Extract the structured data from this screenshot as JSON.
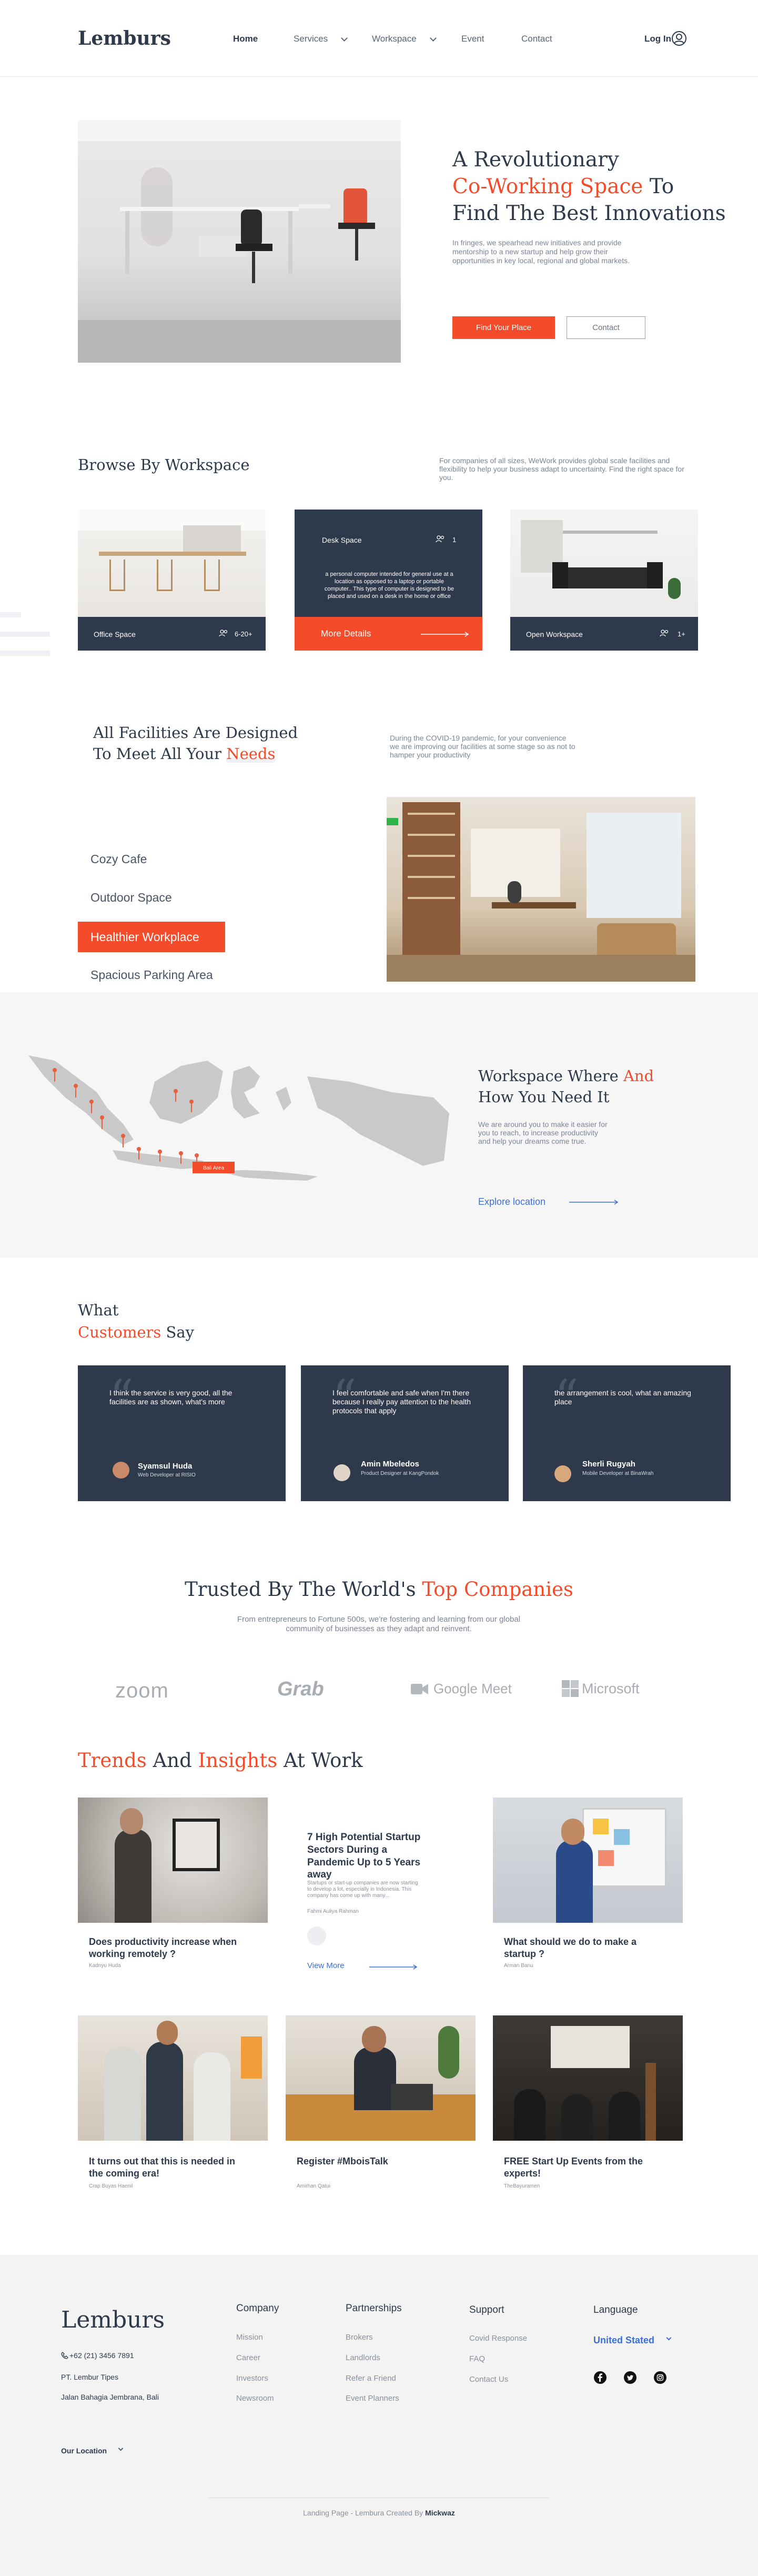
{
  "nav": {
    "logo": "Lemburs",
    "links": [
      "Home",
      "Services",
      "Workspace",
      "Event",
      "Contact"
    ],
    "login": "Log In"
  },
  "hero": {
    "title_1": "A Revolutionary",
    "title_accent": "Co-Working Space",
    "title_2": "To",
    "title_3": "Find The Best Innovations",
    "desc": "In fringes, we spearhead new initiatives and provide mentorship to a new startup and help grow their opportunities in key local, regional and global markets.",
    "cta_primary": "Find Your Place",
    "cta_secondary": "Contact"
  },
  "browse": {
    "title": "Browse By Workspace",
    "desc": "For companies of all sizes, WeWork provides global scale facilities and flexibility to help your business adapt to uncertainty. Find the right space for you.",
    "cards": [
      {
        "label": "Office Space",
        "count": "6-20+"
      },
      {
        "label": "Desk Space",
        "count": "1",
        "body": "a personal computer intended for general use at a location as opposed to a laptop or portable computer.. This type of computer is designed to be placed and used on a desk in the home or office",
        "more": "More Details"
      },
      {
        "label": "Open Workspace",
        "count": "1+"
      }
    ]
  },
  "facilities": {
    "title_1": "All Facilities Are Designed",
    "title_2": "To Meet All Your",
    "title_accent": "Needs",
    "desc": "During the COVID-19 pandemic, for your convenience we are improving our facilities at some stage so as not to hamper your productivity",
    "items": [
      "Cozy Cafe",
      "Outdoor Space",
      "Healthier Workplace",
      "Spacious Parking Area"
    ]
  },
  "map": {
    "title_1": "Workspace Where",
    "title_accent": "And",
    "title_2": "How You Need It",
    "desc": "We are around you to make it easier for you to reach, to increase productivity and help your dreams come true.",
    "link": "Explore location",
    "marker_label": "Bali Area"
  },
  "testimonials": {
    "title_1": "What",
    "title_accent": "Customers",
    "title_2": "Say",
    "items": [
      {
        "quote": "I think the service is very good, all the facilities are as shown, what's more",
        "name": "Syamsul Huda",
        "role": "Web Developer at RISIO"
      },
      {
        "quote": "I feel comfortable and safe when I'm there because I really pay attention to the health protocols that apply",
        "name": "Amin Mbeledos",
        "role": "Product Designer at KangPondok"
      },
      {
        "quote": "the arrangement is cool, what an amazing place",
        "name": "Sherli Rugyah",
        "role": "Mobile Developer at BinaWrah"
      }
    ]
  },
  "trusted": {
    "title_1": "Trusted By The World's",
    "title_accent": "Top Companies",
    "desc": "From entrepreneurs to Fortune 500s, we're fostering and learning from our global community of businesses as they adapt and reinvent.",
    "brands": [
      "zoom",
      "Grab",
      "Google Meet",
      "Microsoft"
    ]
  },
  "insights": {
    "title_a1": "Trends",
    "title_m": "And",
    "title_a2": "Insights",
    "title_e": "At Work",
    "featured": {
      "title": "7 High Potential Startup Sectors During a Pandemic Up to 5 Years away",
      "excerpt": "Startups or start-up companies are now starting to develop a lot, especially in Indonesia. This company has come up with many...",
      "author": "Fahmi Auliya Rahman",
      "more": "View More"
    },
    "posts": [
      {
        "title": "Does productivity increase when working remotely ?",
        "author": "Kadnyu Huda"
      },
      {
        "title": "What should we do to make a startup ?",
        "author": "Arman Banu"
      },
      {
        "title": "It turns out that this is needed in the coming era!",
        "author": "Crap Buyas Haenil"
      },
      {
        "title": "Register #MboisTalk",
        "author": "Amirhan Qatui"
      },
      {
        "title": "FREE Start Up Events from the experts!",
        "author": "TheBayuramen"
      }
    ]
  },
  "footer": {
    "logo": "Lemburs",
    "phone": "+62 (21) 3456 7891",
    "company": "PT. Lembur Tipes",
    "address": "Jalan Bahagia Jembrana, Bali",
    "location": "Our Location",
    "cols": [
      {
        "title": "Company",
        "links": [
          "Mission",
          "Career",
          "Investors",
          "Newsroom"
        ]
      },
      {
        "title": "Partnerships",
        "links": [
          "Brokers",
          "Landlords",
          "Refer a Friend",
          "Event Planners"
        ]
      },
      {
        "title": "Support",
        "links": [
          "Covid Response",
          "FAQ",
          "Contact Us"
        ]
      }
    ],
    "lang_title": "Language",
    "lang_value": "United Stated",
    "credit": "Landing Page - Lembura Created By",
    "credit_name": "Mickwaz"
  },
  "colors": {
    "accent": "#f44b2a",
    "navy": "#2e3a4b",
    "link": "#3b6fd8"
  }
}
